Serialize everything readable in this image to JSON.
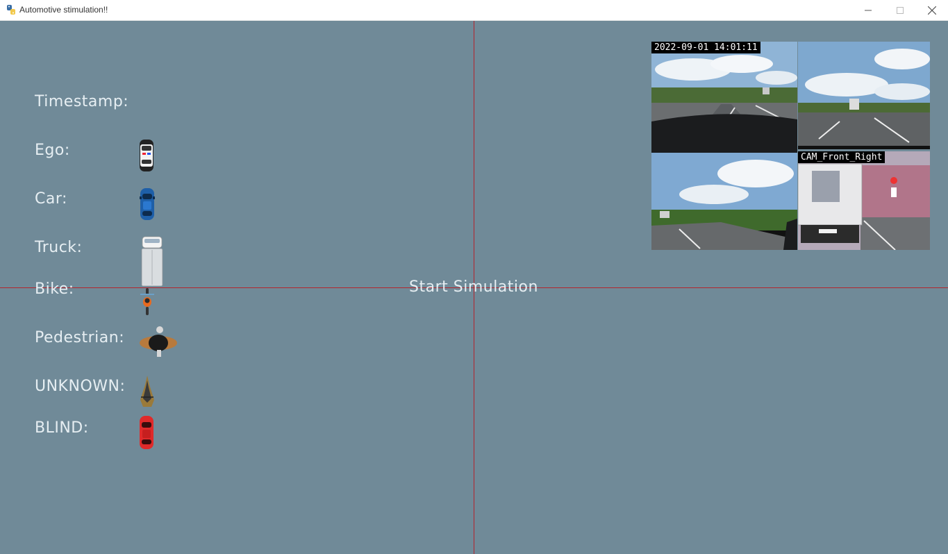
{
  "window": {
    "title": "Automotive stimulation!!",
    "minimize_icon": "minimize-icon",
    "maximize_icon": "maximize-icon",
    "close_icon": "close-icon"
  },
  "legend": [
    {
      "label": "Timestamp:",
      "icon": null
    },
    {
      "label": "Ego:",
      "icon": "police-car-icon"
    },
    {
      "label": "Car:",
      "icon": "blue-car-icon"
    },
    {
      "label": "Truck:",
      "icon": "truck-icon"
    },
    {
      "label": "Bike:",
      "icon": "bike-icon"
    },
    {
      "label": "Pedestrian:",
      "icon": "pedestrian-icon"
    },
    {
      "label": "UNKNOWN:",
      "icon": "unknown-icon"
    },
    {
      "label": "BLIND:",
      "icon": "red-car-icon"
    }
  ],
  "start_button": "Start Simulation",
  "cameras": {
    "top_left_timestamp": "2022-09-01 14:01:11",
    "bottom_right_name": "CAM_Front_Right"
  },
  "colors": {
    "background": "#708a98",
    "crosshair": "#b3252d",
    "text": "#e6eef2"
  }
}
